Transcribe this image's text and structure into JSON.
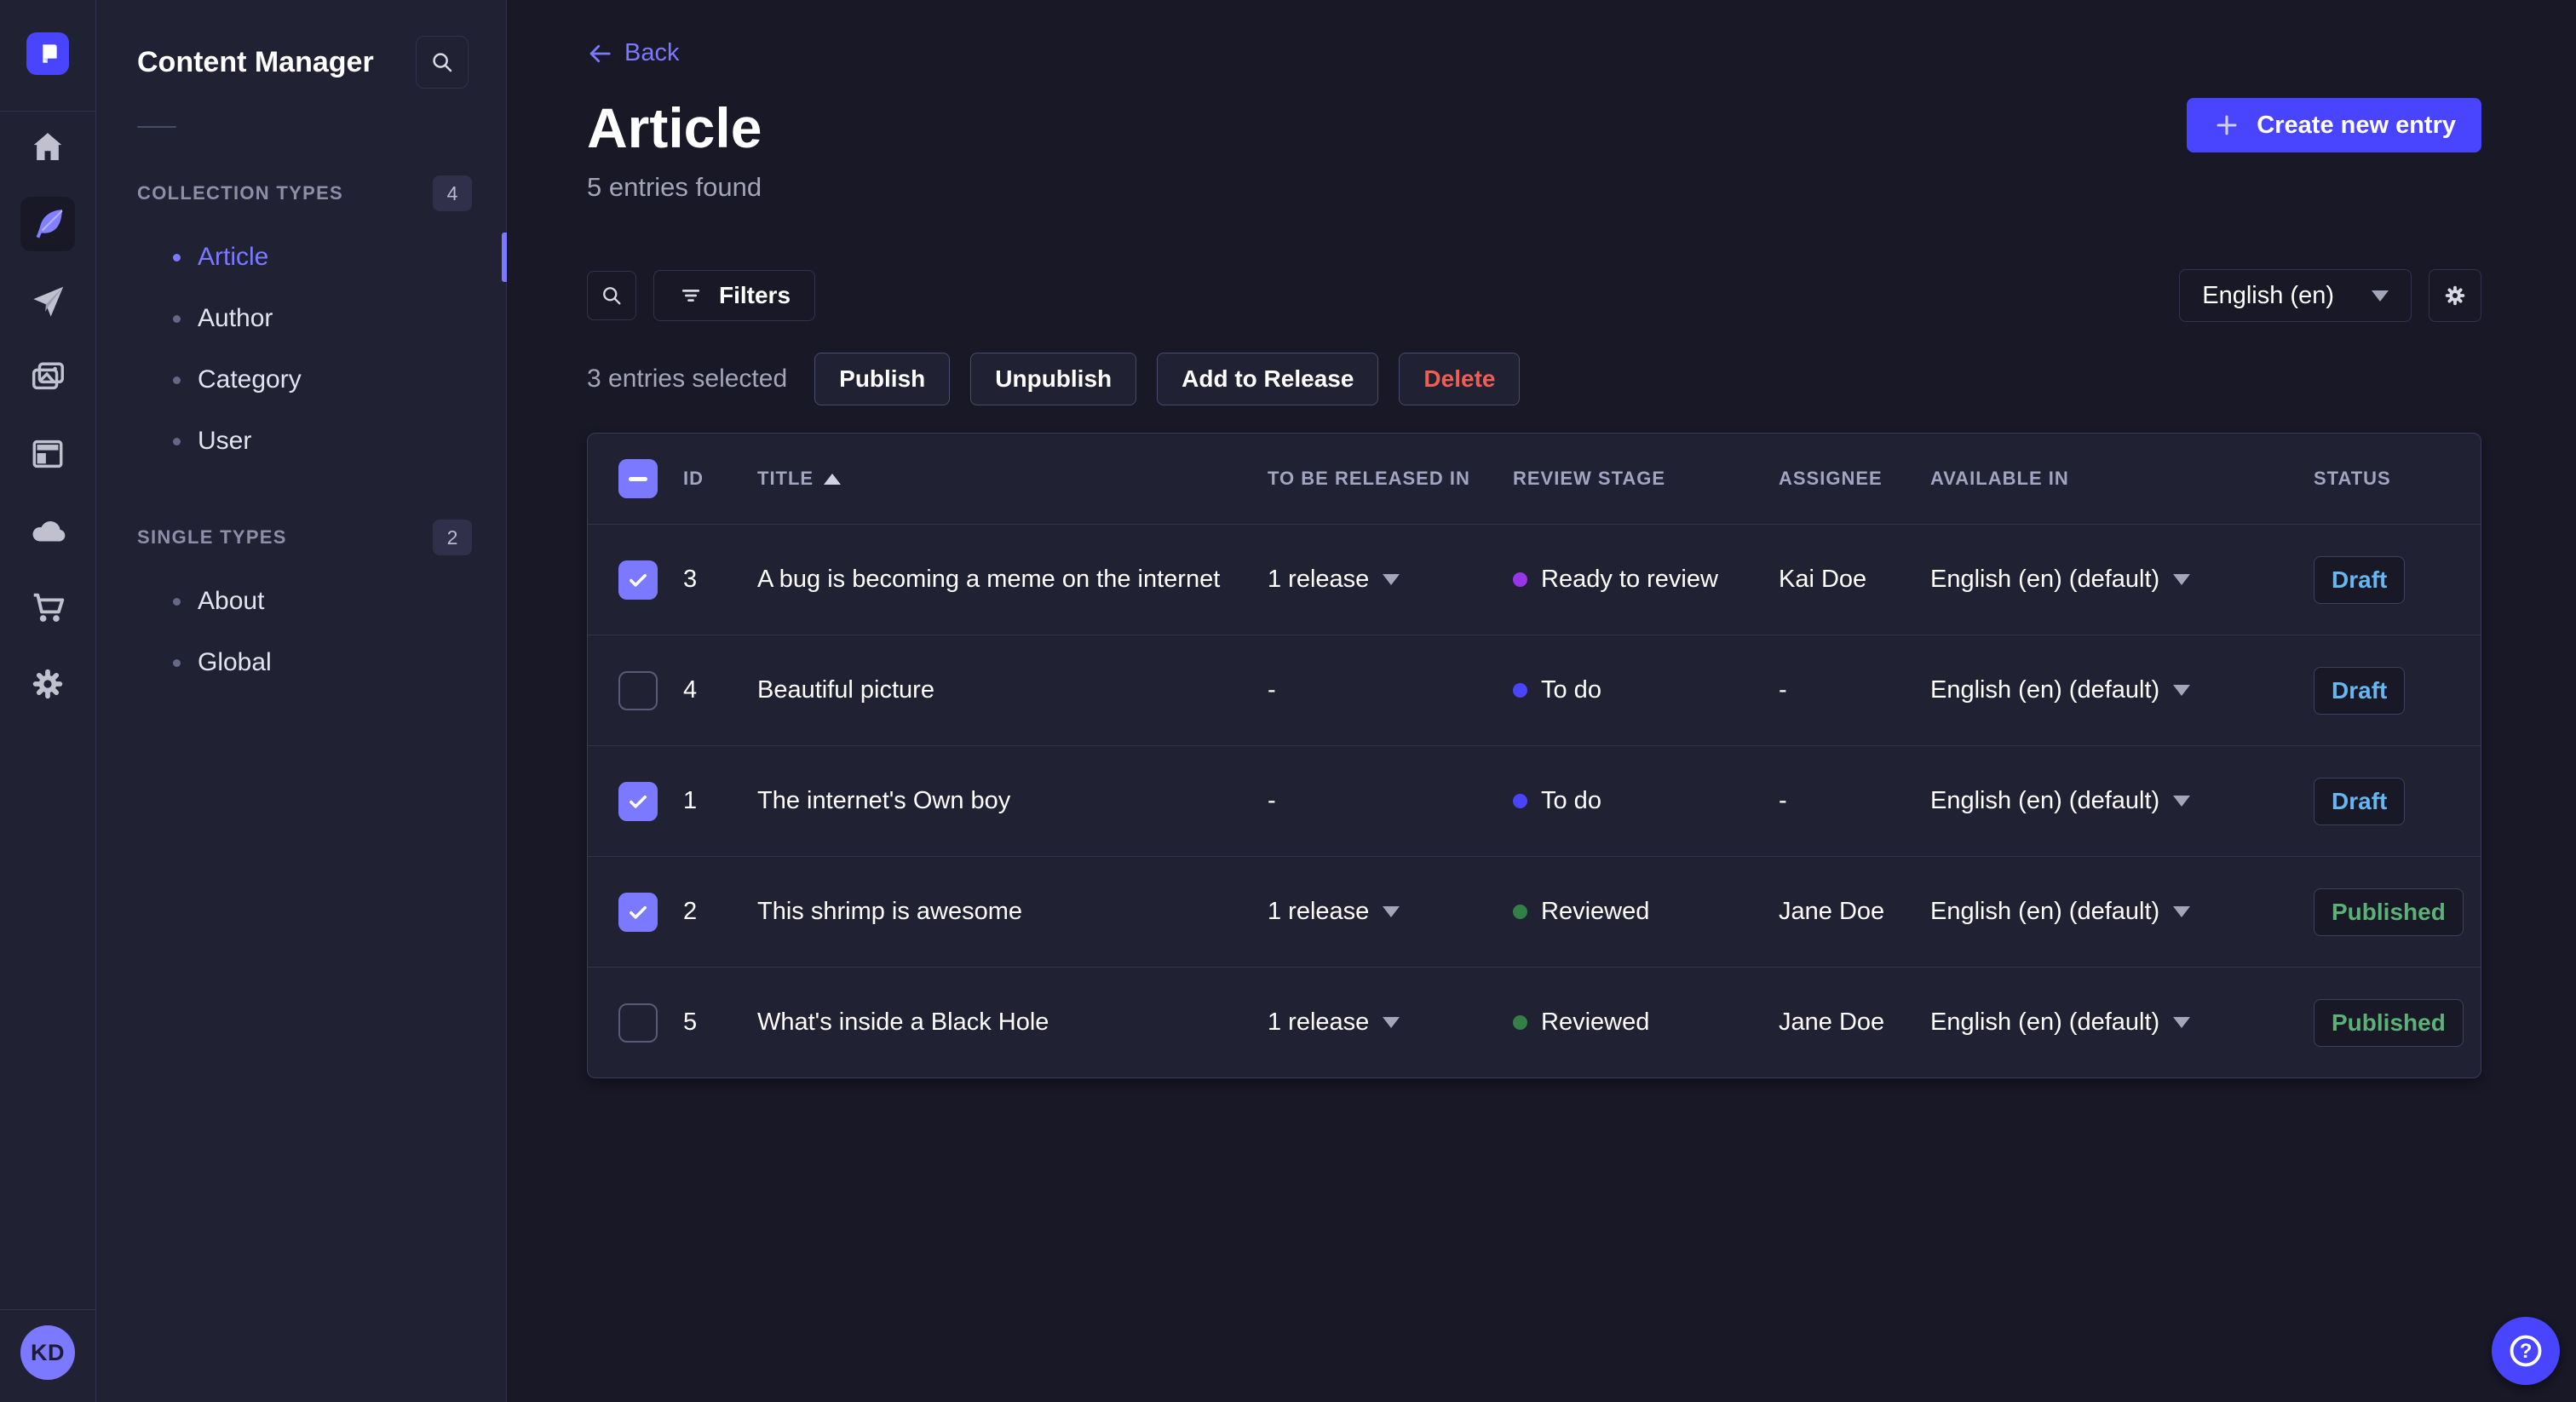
{
  "colors": {
    "primary": "#4945ff",
    "primary_light": "#7b79ff",
    "draft": "#66b7f1",
    "published": "#5cb176",
    "delete": "#ee5e52"
  },
  "icons": {
    "help_glyph": "?"
  },
  "rail": {
    "avatar_initials": "KD"
  },
  "sidebar": {
    "title": "Content Manager",
    "sections": [
      {
        "label": "COLLECTION TYPES",
        "badge": "4",
        "items": [
          {
            "label": "Article"
          },
          {
            "label": "Author"
          },
          {
            "label": "Category"
          },
          {
            "label": "User"
          }
        ]
      },
      {
        "label": "SINGLE TYPES",
        "badge": "2",
        "items": [
          {
            "label": "About"
          },
          {
            "label": "Global"
          }
        ]
      }
    ]
  },
  "header": {
    "back_label": "Back",
    "title": "Article",
    "subtitle": "5 entries found",
    "create_button": "Create new entry"
  },
  "toolbar": {
    "filters_label": "Filters",
    "locale_value": "English (en)"
  },
  "selection": {
    "text": "3 entries selected",
    "publish": "Publish",
    "unpublish": "Unpublish",
    "add_to_release": "Add to Release",
    "delete": "Delete"
  },
  "table": {
    "columns": [
      "ID",
      "TITLE",
      "TO BE RELEASED IN",
      "REVIEW STAGE",
      "ASSIGNEE",
      "AVAILABLE IN",
      "STATUS"
    ],
    "rows": [
      {
        "checked": true,
        "id": "3",
        "title": "A bug is becoming a meme on the internet",
        "releases": "1 release",
        "releases_caret": true,
        "stage": "Ready to review",
        "stage_color": "#9736e8",
        "assignee": "Kai Doe",
        "locale": "English (en) (default)",
        "status": "Draft",
        "status_color": "#66b7f1"
      },
      {
        "checked": false,
        "id": "4",
        "title": "Beautiful picture",
        "releases": "-",
        "releases_caret": false,
        "stage": "To do",
        "stage_color": "#4945ff",
        "assignee": "-",
        "locale": "English (en) (default)",
        "status": "Draft",
        "status_color": "#66b7f1"
      },
      {
        "checked": true,
        "id": "1",
        "title": "The internet's Own boy",
        "releases": "-",
        "releases_caret": false,
        "stage": "To do",
        "stage_color": "#4945ff",
        "assignee": "-",
        "locale": "English (en) (default)",
        "status": "Draft",
        "status_color": "#66b7f1"
      },
      {
        "checked": true,
        "id": "2",
        "title": "This shrimp is awesome",
        "releases": "1 release",
        "releases_caret": true,
        "stage": "Reviewed",
        "stage_color": "#328048",
        "assignee": "Jane Doe",
        "locale": "English (en) (default)",
        "status": "Published",
        "status_color": "#5cb176"
      },
      {
        "checked": false,
        "id": "5",
        "title": "What's inside a Black Hole",
        "releases": "1 release",
        "releases_caret": true,
        "stage": "Reviewed",
        "stage_color": "#328048",
        "assignee": "Jane Doe",
        "locale": "English (en) (default)",
        "status": "Published",
        "status_color": "#5cb176"
      }
    ]
  }
}
